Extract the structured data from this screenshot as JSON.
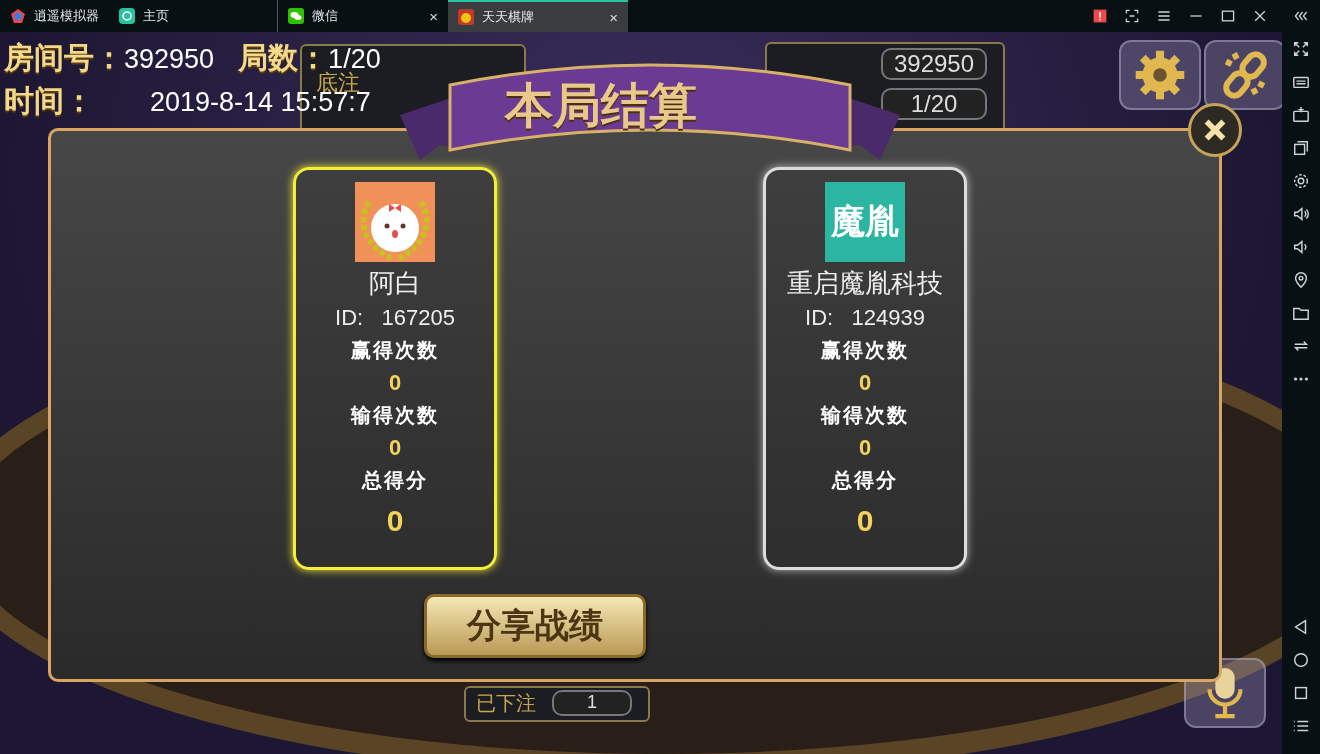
{
  "tabs": [
    {
      "label": "逍遥模拟器",
      "kind": "brand",
      "selected": false
    },
    {
      "label": "主页",
      "kind": "home",
      "selected": false
    },
    {
      "label": "微信",
      "kind": "chat",
      "selected": false,
      "close": "×"
    },
    {
      "label": "天天棋牌",
      "kind": "game",
      "selected": true,
      "close": "×"
    }
  ],
  "game": {
    "room_label": "房间号：",
    "room_number": "392950",
    "round_label": "局数：",
    "round": "1/20",
    "time_label": "时间：",
    "time": "2019-8-14 15:57:7",
    "base_bet_label": "底注",
    "table_room": "392950",
    "table_round": "1/20",
    "bet_label": "已下注",
    "bet": "1",
    "dialog": {
      "title": "本局结算",
      "share_button": "分享战绩",
      "players": [
        {
          "name": "阿白",
          "id_label": "ID:",
          "id": "167205",
          "winner": true,
          "stats": [
            {
              "label": "赢得次数",
              "value": "0"
            },
            {
              "label": "输得次数",
              "value": "0"
            },
            {
              "label": "总得分",
              "value": "0",
              "kind": "total"
            }
          ]
        },
        {
          "name": "重启魔胤科技",
          "id_label": "ID:",
          "id": "124939",
          "winner": false,
          "avatar_text": "魔胤",
          "stats": [
            {
              "label": "赢得次数",
              "value": "0"
            },
            {
              "label": "输得次数",
              "value": "0"
            },
            {
              "label": "总得分",
              "value": "0",
              "kind": "total"
            }
          ]
        }
      ]
    }
  }
}
